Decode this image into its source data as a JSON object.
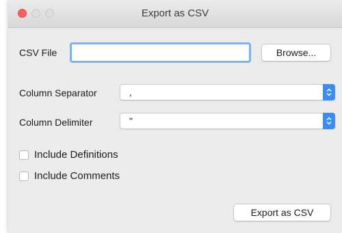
{
  "window": {
    "title": "Export as CSV"
  },
  "form": {
    "csv_file_label": "CSV File",
    "csv_file_value": "",
    "browse_label": "Browse...",
    "column_separator_label": "Column Separator",
    "column_separator_value": ",",
    "column_delimiter_label": "Column Delimiter",
    "column_delimiter_value": "\"",
    "include_definitions_label": "Include Definitions",
    "include_definitions_checked": false,
    "include_comments_label": "Include Comments",
    "include_comments_checked": false,
    "export_label": "Export as CSV"
  },
  "colors": {
    "accent": "#3b8df5",
    "focus_ring": "#7fb2ea",
    "close_button": "#fc605c",
    "window_background": "#ececec"
  }
}
